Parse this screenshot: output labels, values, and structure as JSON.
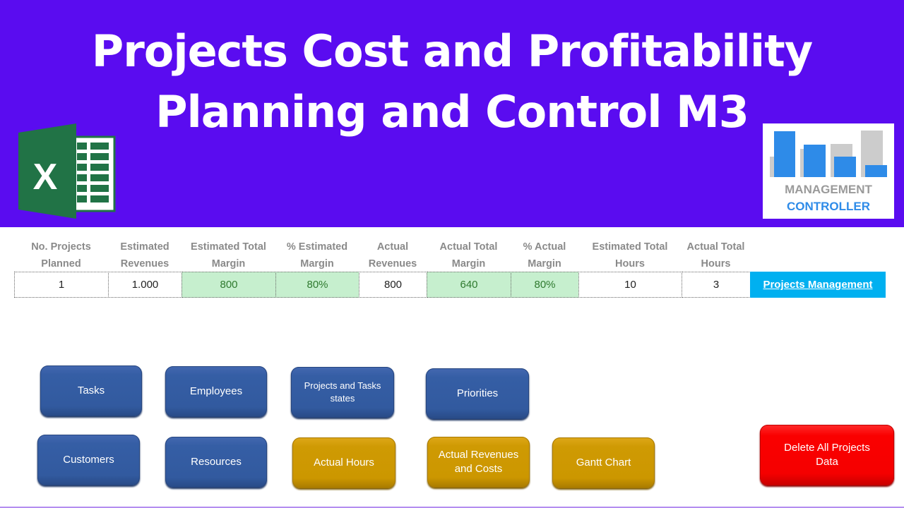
{
  "banner": {
    "title_line1": "Projects Cost and Profitability",
    "title_line2": "Planning and Control M3",
    "excel_logo_letter": "X",
    "brand_logo": {
      "line1": "MANAGEMENT",
      "line2": "CONTROLLER"
    },
    "background_color": "#5a0cf0"
  },
  "kpis": [
    {
      "label_line1": "No. Projects",
      "label_line2": "Planned",
      "value": "1",
      "highlight": false
    },
    {
      "label_line1": "Estimated",
      "label_line2": "Revenues",
      "value": "1.000",
      "highlight": false
    },
    {
      "label_line1": "Estimated Total",
      "label_line2": "Margin",
      "value": "800",
      "highlight": true
    },
    {
      "label_line1": "% Estimated",
      "label_line2": "Margin",
      "value": "80%",
      "highlight": true
    },
    {
      "label_line1": "Actual",
      "label_line2": "Revenues",
      "value": "800",
      "highlight": false
    },
    {
      "label_line1": "Actual Total",
      "label_line2": "Margin",
      "value": "640",
      "highlight": true
    },
    {
      "label_line1": "% Actual",
      "label_line2": "Margin",
      "value": "80%",
      "highlight": true
    },
    {
      "label_line1": "Estimated Total",
      "label_line2": "Hours",
      "value": "10",
      "highlight": false
    },
    {
      "label_line1": "Actual Total",
      "label_line2": "Hours",
      "value": "3",
      "highlight": false
    }
  ],
  "projects_management_link": "Projects Management",
  "buttons": {
    "tasks": "Tasks",
    "employees": "Employees",
    "projects_tasks_states": "Projects and Tasks states",
    "priorities": "Priorities",
    "customers": "Customers",
    "resources": "Resources",
    "actual_hours": "Actual Hours",
    "actual_revenues_costs": "Actual Revenues and Costs",
    "gantt_chart": "Gantt Chart",
    "delete_all": "Delete All Projects Data"
  },
  "colors": {
    "nav_blue": "#325a9f",
    "nav_gold": "#cc9700",
    "danger_red": "#f50000",
    "link_bg": "#00b0f0",
    "highlight_green_bg": "#c6efce",
    "highlight_green_text": "#2f7a2f"
  }
}
